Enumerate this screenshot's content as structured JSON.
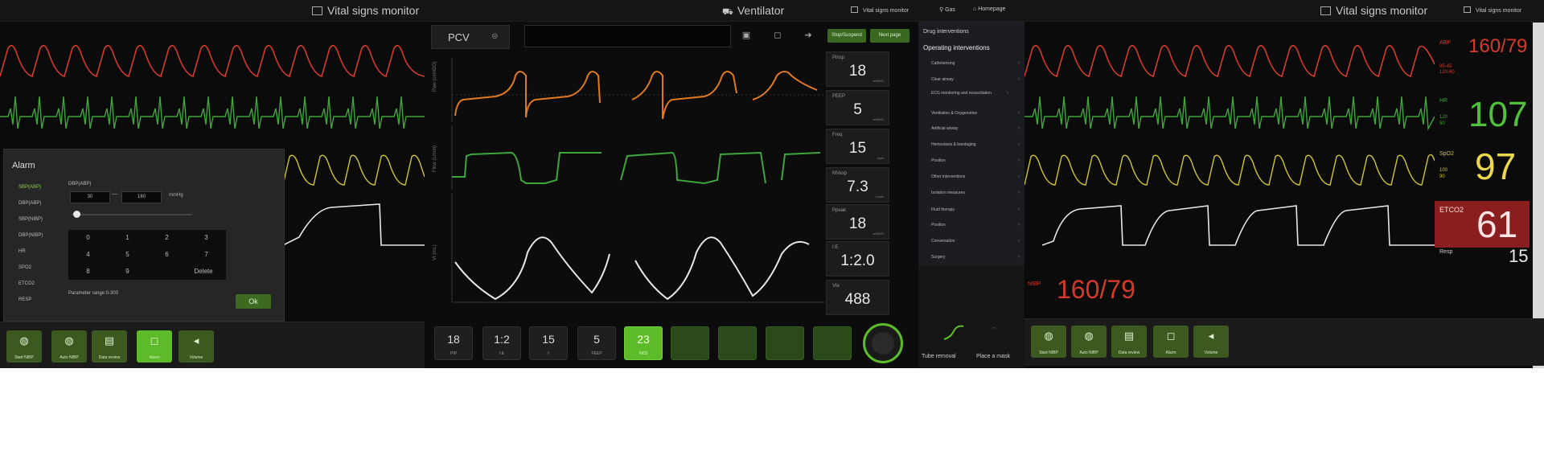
{
  "left_monitor": {
    "title": "Vital signs monitor",
    "alarm": {
      "title": "Alarm",
      "items": [
        "SBP(ABP)",
        "DBP(ABP)",
        "SBP(NIBP)",
        "DBP(NIBP)",
        "HR",
        "SPO2",
        "ETCO2",
        "RESP"
      ],
      "field_label": "DBP(ABP)",
      "low_value": "30",
      "high_value": "160",
      "unit": "mmHg",
      "keypad": [
        "0",
        "1",
        "2",
        "3",
        "4",
        "5",
        "6",
        "7",
        "8",
        "9",
        "Delete"
      ],
      "range_text": "Parameter range:0-300",
      "ok_label": "Ok"
    },
    "buttons": [
      {
        "label": "Start NIBP",
        "glyph": "◍",
        "active": false
      },
      {
        "label": "Auto NIBP",
        "glyph": "◍",
        "active": false
      },
      {
        "label": "Data review",
        "glyph": "▤",
        "active": false
      },
      {
        "label": "Alarm",
        "glyph": "◻",
        "active": true
      },
      {
        "label": "Volume",
        "glyph": "◂",
        "active": false
      }
    ]
  },
  "ventilator": {
    "title": "Ventilator",
    "nav": {
      "vital": "Vital signs monitor",
      "gas": "Gas",
      "home": "Homepage"
    },
    "mode": "PCV",
    "tags": {
      "stop": "Stop/Suspend",
      "next": "Next page"
    },
    "params": [
      {
        "label": "Pinsp",
        "value": "18",
        "unit": "cmH2O"
      },
      {
        "label": "PEEP",
        "value": "5",
        "unit": "cmH2O"
      },
      {
        "label": "Freq",
        "value": "15",
        "unit": "bpm"
      },
      {
        "label": "MVexp",
        "value": "7.3",
        "unit": "L/min"
      },
      {
        "label": "Ppeak",
        "value": "18",
        "unit": "cmH2O"
      },
      {
        "label": "I:E",
        "value": "1:2.0",
        "unit": ""
      },
      {
        "label": "Vte",
        "value": "488",
        "unit": ""
      }
    ],
    "bottom": [
      {
        "value": "18",
        "label": "PIP"
      },
      {
        "value": "1:2",
        "label": "I:E"
      },
      {
        "value": "15",
        "label": "f"
      },
      {
        "value": "5",
        "label": "PEEP"
      },
      {
        "value": "23",
        "label": "FiO2"
      }
    ],
    "interventions": {
      "drug_header": "Drug interventions",
      "op_header": "Operating interventions",
      "items": [
        "Catheterizing",
        "Clear airway",
        "ECG monitoring and resuscitation",
        "Ventilation & Oxygenation",
        "Artificial airway",
        "Hemostasis & bandaging",
        "Position",
        "Other interventions",
        "Isolation measures",
        "Fluid therapy",
        "Position",
        "Conversation",
        "Surgery"
      ],
      "actions": [
        "Tube removal",
        "Place a mask"
      ]
    }
  },
  "right_monitor": {
    "title": "Vital signs monitor",
    "header_right": "Vital signs monitor",
    "abp": {
      "label": "ABP",
      "value": "160/79",
      "sub": "95-45\n120-60"
    },
    "hr": {
      "label": "HR",
      "value": "107",
      "sub": "120\n50"
    },
    "spo2": {
      "label": "SpO2",
      "value": "97",
      "sub": "100\n90"
    },
    "etco2": {
      "label": "ETCO2",
      "value": "61"
    },
    "resp": {
      "label": "Resp",
      "value": "15"
    },
    "nibp": {
      "label": "NIBP",
      "value": "160/79"
    },
    "buttons": [
      {
        "label": "Start NIBP",
        "glyph": "◍"
      },
      {
        "label": "Auto NIBP",
        "glyph": "◍"
      },
      {
        "label": "Data review",
        "glyph": "▤"
      },
      {
        "label": "Alarm",
        "glyph": "◻"
      },
      {
        "label": "Volume",
        "glyph": "◂"
      }
    ]
  },
  "colors": {
    "ecg": "#3ea63a",
    "abp": "#d43a2c",
    "pleth": "#cfc434",
    "co2": "#e8e8e8",
    "pressure": "#e07a22",
    "accent": "#5dbb2a"
  }
}
